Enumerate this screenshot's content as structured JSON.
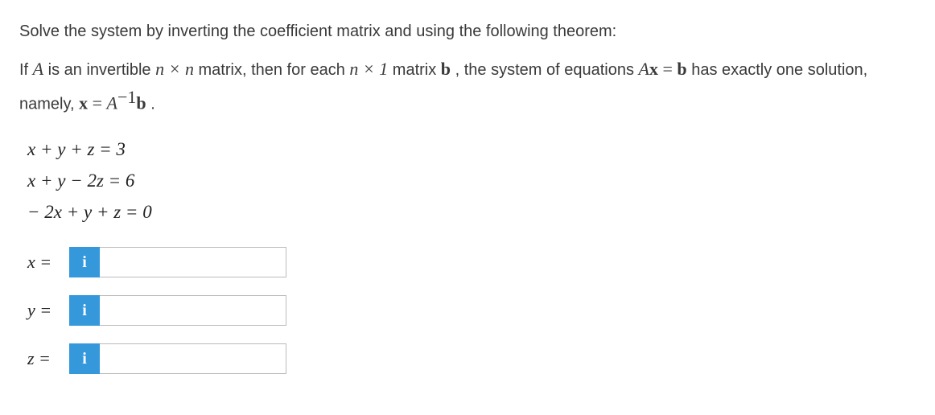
{
  "question": {
    "line1": "Solve the system by inverting the coefficient matrix and using the following theorem:",
    "theorem_part1": "If ",
    "theorem_A": "A",
    "theorem_part2": " is an invertible ",
    "theorem_nxn": "n × n",
    "theorem_part3": " matrix, then for each ",
    "theorem_nx1": "n × 1",
    "theorem_part4": " matrix ",
    "theorem_b": "b",
    "theorem_part5": " , the system of equations ",
    "theorem_Ax": "A",
    "theorem_x": "x",
    "theorem_eq": " = ",
    "theorem_b2": "b",
    "theorem_part6": " has exactly one solution, namely, ",
    "theorem_x2": "x",
    "theorem_eq2": " = ",
    "theorem_Ainv": "A",
    "theorem_exp": "−1",
    "theorem_b3": "b",
    "theorem_dot": " ."
  },
  "equations": {
    "eq1": "x + y + z = 3",
    "eq2": "x + y − 2z = 6",
    "eq3": "− 2x + y + z = 0"
  },
  "answers": {
    "x_label": "x =",
    "y_label": "y =",
    "z_label": "z =",
    "info_symbol": "i",
    "x_value": "",
    "y_value": "",
    "z_value": ""
  }
}
